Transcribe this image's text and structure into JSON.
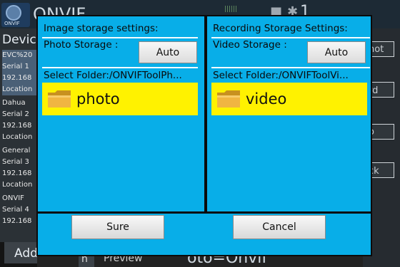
{
  "background": {
    "logo_text": "ONVIF",
    "title": "ONVIF",
    "left_header": "Devic",
    "devices": [
      {
        "name": "EVC%20",
        "serial": "Serial 1",
        "ip": "192.168",
        "location": "Location"
      },
      {
        "name": "Dahua",
        "serial": "Serial 2",
        "ip": "192.168",
        "location": "Location"
      },
      {
        "name": "General",
        "serial": "Serial 3",
        "ip": "192.168",
        "location": "Location"
      },
      {
        "name": "ONVIF",
        "serial": "Serial 4",
        "ip": "192.168",
        "location": ""
      }
    ],
    "add_label": "Add",
    "right_labels": [
      "hot",
      "rd",
      "o",
      "ck"
    ],
    "bottom_tab": "h",
    "bottom_preview": "Preview",
    "bottom_big_text": "oto=Onvif"
  },
  "dialog": {
    "photo": {
      "title": "Image storage settings:",
      "storage_label": "Photo Storage :",
      "auto_label": "Auto",
      "folder_path": "Select Folder:/ONVIFToolPh...",
      "folder_name": "photo"
    },
    "video": {
      "title": "Recording Storage Settings:",
      "storage_label": "Video Storage :",
      "auto_label": "Auto",
      "folder_path": "Select Folder:/ONVIFToolVi...",
      "folder_name": "video"
    },
    "sure_label": "Sure",
    "cancel_label": "Cancel"
  }
}
